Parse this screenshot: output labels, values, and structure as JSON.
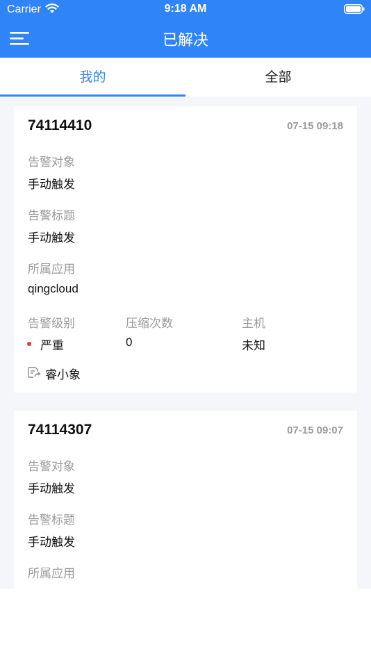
{
  "status_bar": {
    "carrier": "Carrier",
    "time": "9:18 AM",
    "wifi_icon": "wifi-icon",
    "battery_icon": "battery-icon"
  },
  "nav": {
    "title": "已解决",
    "menu_icon": "menu-icon"
  },
  "tabs": [
    {
      "label": "我的",
      "active": true
    },
    {
      "label": "全部",
      "active": false
    }
  ],
  "colors": {
    "accent": "#2f84f7",
    "severity_critical": "#e53935",
    "list_background": "#f4f6fa"
  },
  "alerts": [
    {
      "id": "74114410",
      "time": "07-15 09:18",
      "object_label": "告警对象",
      "object_value": "手动触发",
      "title_label": "告警标题",
      "title_value": "手动触发",
      "app_label": "所属应用",
      "app_value": "qingcloud",
      "level_label": "告警级别",
      "level_value": "严重",
      "compress_label": "压缩次数",
      "compress_value": "0",
      "host_label": "主机",
      "host_value": "未知",
      "assignee": "睿小象"
    },
    {
      "id": "74114307",
      "time": "07-15 09:07",
      "object_label": "告警对象",
      "object_value": "手动触发",
      "title_label": "告警标题",
      "title_value": "手动触发",
      "app_label": "所属应用"
    }
  ]
}
